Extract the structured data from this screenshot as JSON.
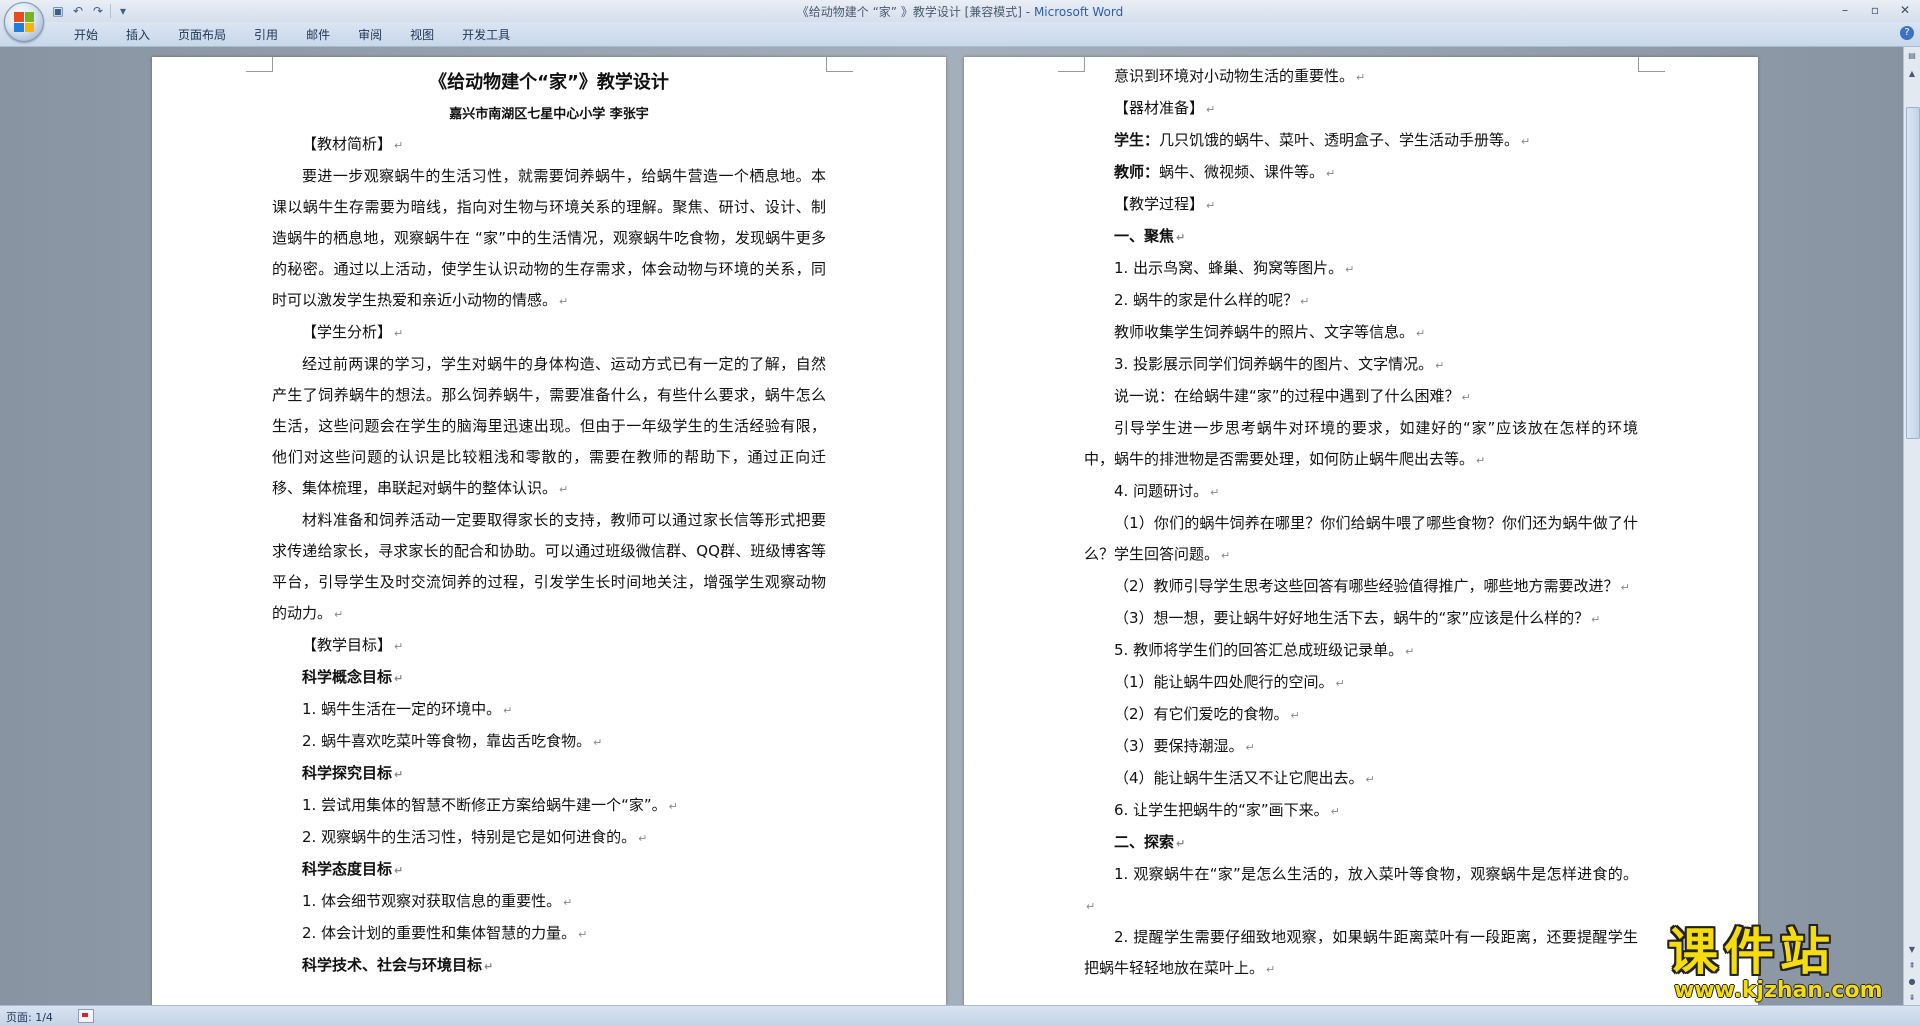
{
  "titlebar": {
    "title": "《给动物建个  “家”  》教学设计 [兼容模式] - ",
    "app_name": "Microsoft Word",
    "qat": [
      "save-icon",
      "undo-icon",
      "redo-icon",
      "customize-icon"
    ],
    "window_controls": [
      "–",
      "▫",
      "✕"
    ]
  },
  "ribbon": {
    "tabs": [
      "开始",
      "插入",
      "页面布局",
      "引用",
      "邮件",
      "审阅",
      "视图",
      "开发工具"
    ]
  },
  "left_page": {
    "title": "《给动物建个“家”》教学设计",
    "author": "嘉兴市南湖区七星中心小学    李张宇",
    "paragraphs": [
      {
        "style": "sec",
        "text": "【教材简析】"
      },
      {
        "style": "p",
        "text": "要进一步观察蜗牛的生活习性，就需要饲养蜗牛，给蜗牛营造一个栖息地。本课以蜗牛生存需要为暗线，指向对生物与环境关系的理解。聚焦、研讨、设计、制造蜗牛的栖息地，观察蜗牛在 “家”中的生活情况，观察蜗牛吃食物，发现蜗牛更多的秘密。通过以上活动，使学生认识动物的生存需求，体会动物与环境的关系，同时可以激发学生热爱和亲近小动物的情感。"
      },
      {
        "style": "sec",
        "text": "【学生分析】"
      },
      {
        "style": "p",
        "text": "经过前两课的学习，学生对蜗牛的身体构造、运动方式已有一定的了解，自然产生了饲养蜗牛的想法。那么饲养蜗牛，需要准备什么，有些什么要求，蜗牛怎么生活，这些问题会在学生的脑海里迅速出现。但由于一年级学生的生活经验有限，他们对这些问题的认识是比较粗浅和零散的，需要在教师的帮助下，通过正向迁移、集体梳理，串联起对蜗牛的整体认识。"
      },
      {
        "style": "p",
        "text": "材料准备和饲养活动一定要取得家长的支持，教师可以通过家长信等形式把要求传递给家长，寻求家长的配合和协助。可以通过班级微信群、QQ群、班级博客等平台，引导学生及时交流饲养的过程，引发学生长时间地关注，增强学生观察动物的动力。"
      },
      {
        "style": "sec",
        "text": "【教学目标】"
      },
      {
        "style": "sec bold",
        "text": "科学概念目标"
      },
      {
        "style": "sec",
        "text": "1. 蜗牛生活在一定的环境中。"
      },
      {
        "style": "sec",
        "text": "2. 蜗牛喜欢吃菜叶等食物，靠齿舌吃食物。"
      },
      {
        "style": "sec bold",
        "text": "科学探究目标"
      },
      {
        "style": "sec",
        "text": "1. 尝试用集体的智慧不断修正方案给蜗牛建一个“家”。"
      },
      {
        "style": "sec",
        "text": "2. 观察蜗牛的生活习性，特别是它是如何进食的。"
      },
      {
        "style": "sec bold",
        "text": "科学态度目标"
      },
      {
        "style": "sec",
        "text": "1. 体会细节观察对获取信息的重要性。"
      },
      {
        "style": "sec",
        "text": "2. 体会计划的重要性和集体智慧的力量。"
      },
      {
        "style": "sec bold",
        "text": "科学技术、社会与环境目标"
      }
    ]
  },
  "right_page": {
    "paragraphs": [
      {
        "style": "sec",
        "text": "意识到环境对小动物生活的重要性。"
      },
      {
        "style": "sec",
        "text": "【器材准备】"
      },
      {
        "style": "sec",
        "label": "学生：",
        "text": "几只饥饿的蜗牛、菜叶、透明盒子、学生活动手册等。"
      },
      {
        "style": "sec",
        "label": "教师：",
        "text": "蜗牛、微视频、课件等。"
      },
      {
        "style": "sec",
        "text": "【教学过程】"
      },
      {
        "style": "sec bold",
        "text": "一、聚焦"
      },
      {
        "style": "sec",
        "text": "1. 出示鸟窝、蜂巢、狗窝等图片。"
      },
      {
        "style": "sec",
        "text": "2. 蜗牛的家是什么样的呢？"
      },
      {
        "style": "sec",
        "text": "教师收集学生饲养蜗牛的照片、文字等信息。"
      },
      {
        "style": "sec",
        "text": "3. 投影展示同学们饲养蜗牛的图片、文字情况。"
      },
      {
        "style": "sec",
        "text": "说一说：在给蜗牛建“家”的过程中遇到了什么困难？"
      },
      {
        "style": "p",
        "text": "引导学生进一步思考蜗牛对环境的要求，如建好的“家”应该放在怎样的环境中，蜗牛的排泄物是否需要处理，如何防止蜗牛爬出去等。"
      },
      {
        "style": "sec",
        "text": "4. 问题研讨。"
      },
      {
        "style": "p",
        "text": "（1）你们的蜗牛饲养在哪里？你们给蜗牛喂了哪些食物？你们还为蜗牛做了什么？学生回答问题。"
      },
      {
        "style": "sec",
        "text": "（2）教师引导学生思考这些回答有哪些经验值得推广，哪些地方需要改进？"
      },
      {
        "style": "sec",
        "text": "（3）想一想，要让蜗牛好好地生活下去，蜗牛的“家”应该是什么样的？"
      },
      {
        "style": "sec",
        "text": "5. 教师将学生们的回答汇总成班级记录单。"
      },
      {
        "style": "sec",
        "text": "（1）能让蜗牛四处爬行的空间。"
      },
      {
        "style": "sec",
        "text": "（2）有它们爱吃的食物。"
      },
      {
        "style": "sec",
        "text": "（3）要保持潮湿。"
      },
      {
        "style": "sec",
        "text": "（4）能让蜗牛生活又不让它爬出去。"
      },
      {
        "style": "sec",
        "text": "6. 让学生把蜗牛的“家”画下来。"
      },
      {
        "style": "sec bold",
        "text": "二、探索"
      },
      {
        "style": "p",
        "text": "1. 观察蜗牛在“家”是怎么生活的，放入菜叶等食物，观察蜗牛是怎样进食的。"
      },
      {
        "style": "p",
        "text": "2. 提醒学生需要仔细致地观察，如果蜗牛距离菜叶有一段距离，还要提醒学生把蜗牛轻轻地放在菜叶上。"
      }
    ]
  },
  "status": {
    "page": "页面: 1/4"
  },
  "watermark": {
    "big": "课件站",
    "small": "www.kjzhan.com"
  }
}
